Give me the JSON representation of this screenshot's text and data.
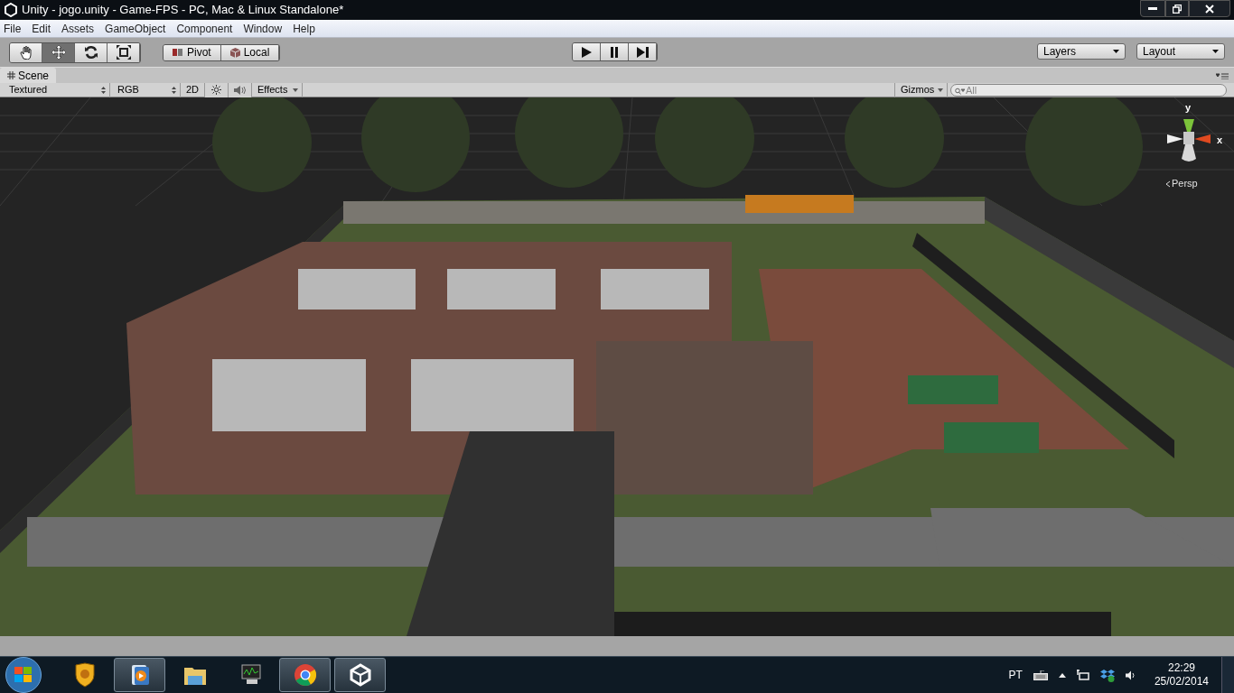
{
  "window": {
    "title": "Unity - jogo.unity - Game-FPS - PC, Mac & Linux Standalone*"
  },
  "menu": [
    "File",
    "Edit",
    "Assets",
    "GameObject",
    "Component",
    "Window",
    "Help"
  ],
  "tools": [
    {
      "kind": "hand",
      "selected": false
    },
    {
      "kind": "move",
      "selected": true
    },
    {
      "kind": "rotate",
      "selected": false
    },
    {
      "kind": "scale",
      "selected": false
    }
  ],
  "handle_buttons": [
    {
      "kind": "pivot",
      "label": "Pivot"
    },
    {
      "kind": "local",
      "label": "Local"
    }
  ],
  "play_buttons": [
    {
      "kind": "play"
    },
    {
      "kind": "pause"
    },
    {
      "kind": "step"
    }
  ],
  "dropdowns": [
    "Layers",
    "Layout"
  ],
  "scene_tab": "Scene",
  "scene_toolbar": {
    "render_mode": "Textured",
    "channel": "RGB",
    "mode_2d": "2D",
    "lighting_on": false,
    "audio_on": false,
    "effects": "Effects",
    "gizmos": "Gizmos",
    "search_placeholder": "All"
  },
  "gizmo": {
    "y_label": "y",
    "x_label": "x",
    "projection": "Persp"
  },
  "taskbar": {
    "apps": [
      {
        "kind": "lion",
        "running": false
      },
      {
        "kind": "media",
        "running": true
      },
      {
        "kind": "folder",
        "running": false
      },
      {
        "kind": "monitor",
        "running": false
      },
      {
        "kind": "chrome",
        "running": true
      },
      {
        "kind": "unity",
        "running": true
      }
    ],
    "language": "PT",
    "time": "22:29",
    "date": "25/02/2014"
  }
}
